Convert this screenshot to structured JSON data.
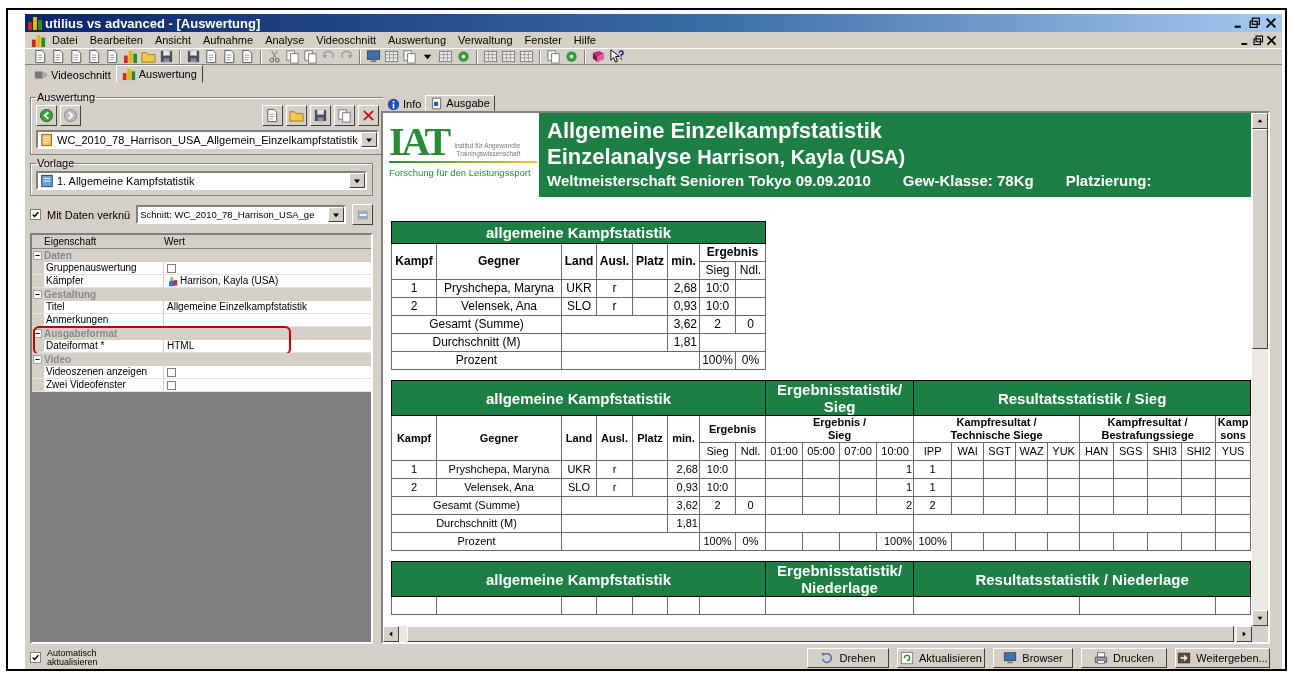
{
  "window": {
    "title": "utilius vs advanced - [Auswertung]"
  },
  "menu": [
    "Datei",
    "Bearbeiten",
    "Ansicht",
    "Aufnahme",
    "Analyse",
    "Videoschnitt",
    "Auswertung",
    "Verwaltung",
    "Fenster",
    "Hilfe"
  ],
  "main_tabs": [
    {
      "label": "Videoschnitt",
      "selected": false
    },
    {
      "label": "Auswertung",
      "selected": true
    }
  ],
  "left_panel": {
    "auswertung": {
      "legend": "Auswertung",
      "file": "WC_2010_78_Harrison_USA_Allgemein_Einzelkampfstatistik"
    },
    "vorlage": {
      "legend": "Vorlage",
      "value": "1. Allgemeine Kampfstatistik"
    },
    "link": {
      "label": "Mit Daten verknü",
      "checked": true,
      "value": "Schnitt: WC_2010_78_Harrison_USA_ge"
    },
    "properties": {
      "columns": [
        "Eigenschaft",
        "Wert"
      ],
      "groups": [
        {
          "name": "Daten",
          "expanded": true,
          "highlighted": false,
          "rows": [
            {
              "name": "Gruppenauswertung",
              "kind": "checkbox",
              "checked": false
            },
            {
              "name": "Kämpfer",
              "kind": "person",
              "value": "Harrison, Kayla (USA)"
            }
          ]
        },
        {
          "name": "Gestaltung",
          "expanded": true,
          "highlighted": false,
          "rows": [
            {
              "name": "Titel",
              "kind": "text",
              "value": "Allgemeine Einzelkampfstatistik"
            },
            {
              "name": "Anmerkungen",
              "kind": "text"
            }
          ]
        },
        {
          "name": "Ausgabeformat",
          "expanded": true,
          "highlighted": true,
          "rows": [
            {
              "name": "Dateiformat *",
              "kind": "text",
              "value": "HTML"
            }
          ]
        },
        {
          "name": "Video",
          "expanded": true,
          "highlighted": false,
          "rows": [
            {
              "name": "Videoszenen anzeigen",
              "kind": "checkbox",
              "checked": false
            },
            {
              "name": "Zwei Videofenster",
              "kind": "checkbox",
              "checked": false
            }
          ]
        }
      ]
    }
  },
  "output_tabs": [
    {
      "label": "Info",
      "selected": false
    },
    {
      "label": "Ausgabe",
      "selected": true
    }
  ],
  "report": {
    "logo": {
      "wordmark": "IAT",
      "institute": [
        "Institut für Angewandte",
        "Trainingswissenschaft"
      ],
      "tagline": "Forschung für den Leistungssport"
    },
    "title": "Allgemeine Einzelkampfstatistik",
    "subtitle": "Einzelanalyse",
    "athlete": "Harrison, Kayla (USA)",
    "details": [
      "Weltmeisterschaft Senioren Tokyo 09.09.2010",
      "Gew-Klasse: 78Kg",
      "Platzierung:"
    ],
    "tables": [
      {
        "rows": [
          [
            {
              "kind": "band",
              "text": "allgemeine Kampfstatistik",
              "colspan": 8
            }
          ],
          [
            {
              "kind": "head",
              "text": "Kampf",
              "rowspan": 2
            },
            {
              "kind": "head",
              "text": "Gegner",
              "rowspan": 2
            },
            {
              "kind": "head",
              "text": "Land",
              "rowspan": 2
            },
            {
              "kind": "head",
              "text": "Ausl.",
              "rowspan": 2
            },
            {
              "kind": "head",
              "text": "Platz",
              "rowspan": 2
            },
            {
              "kind": "head",
              "text": "min.",
              "rowspan": 2
            },
            {
              "kind": "head",
              "text": "Ergebnis",
              "colspan": 2
            }
          ],
          [
            {
              "kind": "sub",
              "text": "Sieg"
            },
            {
              "kind": "sub",
              "text": "Ndl."
            }
          ],
          [
            {
              "kind": "text",
              "text": "1"
            },
            {
              "kind": "text",
              "text": "Pryshchepa, Maryna"
            },
            {
              "kind": "text",
              "text": "UKR"
            },
            {
              "kind": "text",
              "text": "r"
            },
            {},
            {
              "kind": "num",
              "text": "2,68"
            },
            {
              "kind": "text",
              "text": "10:0"
            },
            {}
          ],
          [
            {
              "kind": "text",
              "text": "2"
            },
            {
              "kind": "text",
              "text": "Velensek, Ana"
            },
            {
              "kind": "text",
              "text": "SLO"
            },
            {
              "kind": "text",
              "text": "r"
            },
            {},
            {
              "kind": "num",
              "text": "0,93"
            },
            {
              "kind": "text",
              "text": "10:0"
            },
            {}
          ],
          [
            {
              "kind": "text",
              "text": "Gesamt (Summe)",
              "colspan": 2
            },
            {
              "colspan": 3
            },
            {
              "kind": "num",
              "text": "3,62"
            },
            {
              "kind": "text",
              "text": "2"
            },
            {
              "kind": "text",
              "text": "0"
            }
          ],
          [
            {
              "kind": "text",
              "text": "Durchschnitt (M)",
              "colspan": 2
            },
            {
              "colspan": 3
            },
            {
              "kind": "num",
              "text": "1,81"
            },
            {
              "colspan": 2
            }
          ],
          [
            {
              "kind": "text",
              "text": "Prozent",
              "colspan": 2
            },
            {
              "colspan": 4
            },
            {
              "kind": "text",
              "text": "100%"
            },
            {
              "kind": "text",
              "text": "0%"
            }
          ]
        ]
      },
      {
        "rows": [
          [
            {
              "kind": "band",
              "text": "allgemeine Kampfstatistik",
              "colspan": 8
            },
            {
              "kind": "band",
              "text": "Ergebnisstatistik/\nSieg",
              "colspan": 4
            },
            {
              "kind": "band",
              "text": "Resultatsstatistik / Sieg",
              "colspan": 10
            }
          ],
          [
            {
              "kind": "head",
              "text": "Kampf",
              "rowspan": 2
            },
            {
              "kind": "head",
              "text": "Gegner",
              "rowspan": 2
            },
            {
              "kind": "head",
              "text": "Land",
              "rowspan": 2
            },
            {
              "kind": "head",
              "text": "Ausl.",
              "rowspan": 2
            },
            {
              "kind": "head",
              "text": "Platz",
              "rowspan": 2
            },
            {
              "kind": "head",
              "text": "min.",
              "rowspan": 2
            },
            {
              "kind": "head",
              "text": "Ergebnis",
              "colspan": 2
            },
            {
              "kind": "head",
              "text": "Ergebnis /\nSieg",
              "colspan": 4
            },
            {
              "kind": "head",
              "text": "Kampfresultat /\nTechnische Siege",
              "colspan": 5
            },
            {
              "kind": "head",
              "text": "Kampfresultat /\nBestrafungssiege",
              "colspan": 4
            },
            {
              "kind": "head",
              "text": "Kamp\nsons"
            }
          ],
          [
            {
              "kind": "sub",
              "text": "Sieg"
            },
            {
              "kind": "sub",
              "text": "Ndl."
            },
            {
              "kind": "sub",
              "text": "01:00"
            },
            {
              "kind": "sub",
              "text": "05:00"
            },
            {
              "kind": "sub",
              "text": "07:00"
            },
            {
              "kind": "sub",
              "text": "10:00"
            },
            {
              "kind": "sub",
              "text": "IPP"
            },
            {
              "kind": "sub",
              "text": "WAI"
            },
            {
              "kind": "sub",
              "text": "SGT"
            },
            {
              "kind": "sub",
              "text": "WAZ"
            },
            {
              "kind": "sub",
              "text": "YUK"
            },
            {
              "kind": "sub",
              "text": "HAN"
            },
            {
              "kind": "sub",
              "text": "SGS"
            },
            {
              "kind": "sub",
              "text": "SHI3"
            },
            {
              "kind": "sub",
              "text": "SHI2"
            },
            {
              "kind": "sub",
              "text": "YUS"
            }
          ],
          [
            {
              "kind": "text",
              "text": "1"
            },
            {
              "kind": "text",
              "text": "Pryshchepa, Maryna"
            },
            {
              "kind": "text",
              "text": "UKR"
            },
            {
              "kind": "text",
              "text": "r"
            },
            {},
            {
              "kind": "num",
              "text": "2,68"
            },
            {
              "kind": "text",
              "text": "10:0"
            },
            {},
            {},
            {},
            {},
            {
              "kind": "num",
              "text": "1"
            },
            {
              "kind": "text",
              "text": "1"
            },
            {},
            {},
            {},
            {},
            {},
            {},
            {},
            {},
            {}
          ],
          [
            {
              "kind": "text",
              "text": "2"
            },
            {
              "kind": "text",
              "text": "Velensek, Ana"
            },
            {
              "kind": "text",
              "text": "SLO"
            },
            {
              "kind": "text",
              "text": "r"
            },
            {},
            {
              "kind": "num",
              "text": "0,93"
            },
            {
              "kind": "text",
              "text": "10:0"
            },
            {},
            {},
            {},
            {},
            {
              "kind": "num",
              "text": "1"
            },
            {
              "kind": "text",
              "text": "1"
            },
            {},
            {},
            {},
            {},
            {},
            {},
            {},
            {},
            {}
          ],
          [
            {
              "kind": "text",
              "text": "Gesamt (Summe)",
              "colspan": 2
            },
            {
              "colspan": 3
            },
            {
              "kind": "num",
              "text": "3,62"
            },
            {
              "kind": "text",
              "text": "2"
            },
            {
              "kind": "text",
              "text": "0"
            },
            {},
            {},
            {},
            {
              "kind": "num",
              "text": "2"
            },
            {
              "kind": "text",
              "text": "2"
            },
            {},
            {},
            {},
            {},
            {},
            {},
            {},
            {},
            {}
          ],
          [
            {
              "kind": "text",
              "text": "Durchschnitt (M)",
              "colspan": 2
            },
            {
              "colspan": 3
            },
            {
              "kind": "num",
              "text": "1,81"
            },
            {
              "colspan": 2
            },
            {
              "colspan": 4
            },
            {
              "colspan": 5
            },
            {
              "colspan": 4
            },
            {}
          ],
          [
            {
              "kind": "text",
              "text": "Prozent",
              "colspan": 2
            },
            {
              "colspan": 4
            },
            {
              "kind": "text",
              "text": "100%"
            },
            {
              "kind": "text",
              "text": "0%"
            },
            {},
            {},
            {},
            {
              "kind": "num",
              "text": "100%"
            },
            {
              "kind": "text",
              "text": "100%"
            },
            {},
            {},
            {},
            {},
            {},
            {},
            {},
            {},
            {}
          ]
        ]
      },
      {
        "rows": [
          [
            {
              "kind": "band",
              "text": "allgemeine Kampfstatistik",
              "colspan": 8
            },
            {
              "kind": "band",
              "text": "Ergebnisstatistik/\nNiederlage",
              "colspan": 4
            },
            {
              "kind": "band",
              "text": "Resultatsstatistik / Niederlage",
              "colspan": 10
            }
          ],
          [
            {},
            {},
            {},
            {},
            {},
            {},
            {
              "colspan": 2
            },
            {
              "colspan": 4
            },
            {
              "colspan": 5
            },
            {
              "colspan": 4
            },
            {}
          ]
        ]
      }
    ]
  },
  "bottom_bar": {
    "auto_update": {
      "label": "Automatisch aktualisieren",
      "checked": true
    },
    "buttons": [
      "Drehen",
      "Aktualisieren",
      "Browser",
      "Drucken",
      "Weitergeben..."
    ]
  }
}
